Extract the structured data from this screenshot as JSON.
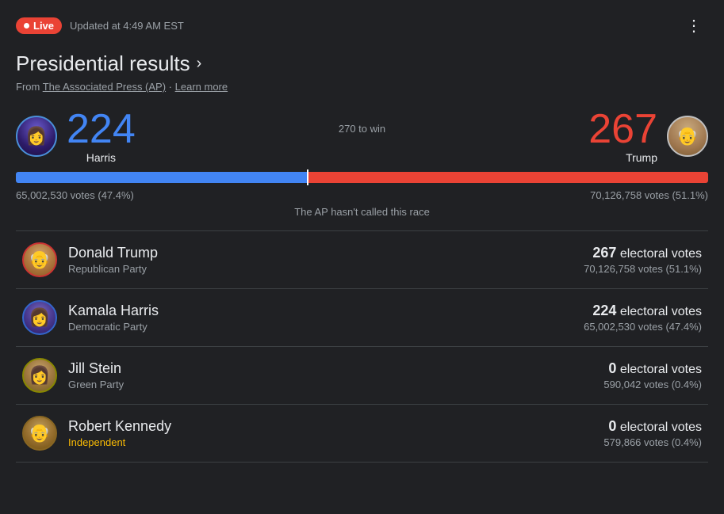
{
  "header": {
    "live_label": "Live",
    "updated_text": "Updated at 4:49 AM EST",
    "more_icon": "⋮"
  },
  "title": {
    "text": "Presidential results",
    "chevron": "›"
  },
  "source": {
    "prefix": "From ",
    "ap_link": "The Associated Press (AP)",
    "separator": " · ",
    "learn_more": "Learn more"
  },
  "scores": {
    "harris": {
      "electoral": "224",
      "label": "Harris"
    },
    "center_label": "270 to win",
    "trump": {
      "electoral": "267",
      "label": "Trump"
    }
  },
  "votes": {
    "harris_votes": "65,002,530 votes (47.4%)",
    "trump_votes": "70,126,758 votes (51.1%)"
  },
  "ap_notice": "The AP hasn't called this race",
  "candidates": [
    {
      "name": "Donald Trump",
      "party": "Republican Party",
      "party_class": "",
      "electoral_label": "electoral votes",
      "electoral_count": "267",
      "popular_votes": "70,126,758 votes (51.1%)"
    },
    {
      "name": "Kamala Harris",
      "party": "Democratic Party",
      "party_class": "",
      "electoral_label": "electoral votes",
      "electoral_count": "224",
      "popular_votes": "65,002,530 votes (47.4%)"
    },
    {
      "name": "Jill Stein",
      "party": "Green Party",
      "party_class": "",
      "electoral_label": "electoral votes",
      "electoral_count": "0",
      "popular_votes": "590,042 votes (0.4%)"
    },
    {
      "name": "Robert Kennedy",
      "party": "Independent",
      "party_class": "independent",
      "electoral_label": "electoral votes",
      "electoral_count": "0",
      "popular_votes": "579,866 votes (0.4%)"
    }
  ]
}
